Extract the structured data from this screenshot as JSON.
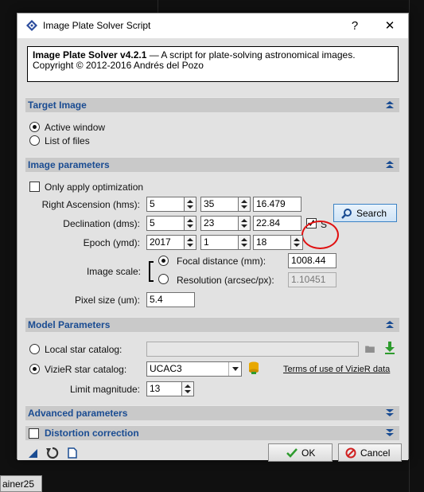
{
  "window": {
    "title": "Image Plate Solver Script",
    "help_label": "?",
    "close_label": "✕"
  },
  "info": {
    "name": "Image Plate Solver v4.2.1",
    "description": " — A script for plate-solving astronomical images.",
    "copyright": "Copyright © 2012-2016 Andrés del Pozo"
  },
  "sections": {
    "target_image": "Target Image",
    "image_parameters": "Image parameters",
    "model_parameters": "Model Parameters",
    "advanced_parameters": "Advanced parameters",
    "distortion_correction": "Distortion correction"
  },
  "target_image": {
    "active_window": "Active window",
    "list_of_files": "List of files",
    "selected": "Active window"
  },
  "image_parameters": {
    "only_apply_optimization": "Only apply optimization",
    "ra_label": "Right Ascension (hms):",
    "ra": [
      "5",
      "35",
      "16.479"
    ],
    "dec_label": "Declination (dms):",
    "dec": [
      "5",
      "23",
      "22.84"
    ],
    "dec_south_label": "S",
    "dec_south_checked": true,
    "epoch_label": "Epoch (ymd):",
    "epoch": [
      "2017",
      "1",
      "18"
    ],
    "search_label": "Search",
    "image_scale_label": "Image scale:",
    "focal_distance_label": "Focal distance (mm):",
    "focal_distance": "1008.44",
    "resolution_label": "Resolution (arcsec/px):",
    "resolution": "1.10451",
    "scale_mode": "Focal distance (mm):",
    "pixel_size_label": "Pixel size (um):",
    "pixel_size": "5.4"
  },
  "model_parameters": {
    "local_catalog_label": "Local star catalog:",
    "local_catalog_value": "",
    "vizier_catalog_label": "VizieR star catalog:",
    "vizier_catalog_value": "UCAC3",
    "terms_link": "Terms of use of VizieR data",
    "limit_magnitude_label": "Limit magnitude:",
    "limit_magnitude": "13",
    "selected": "VizieR star catalog:"
  },
  "buttons": {
    "ok": "OK",
    "cancel": "Cancel"
  },
  "taskbar": {
    "tab_label": "ainer25"
  },
  "colors": {
    "section_title": "#1a4c92",
    "ok_check": "#2e9b2e",
    "cancel_icon": "#d02020",
    "highlight_circle": "#e01010",
    "download_arrow": "#2e9b2e",
    "database_icon": "#e8a800"
  }
}
